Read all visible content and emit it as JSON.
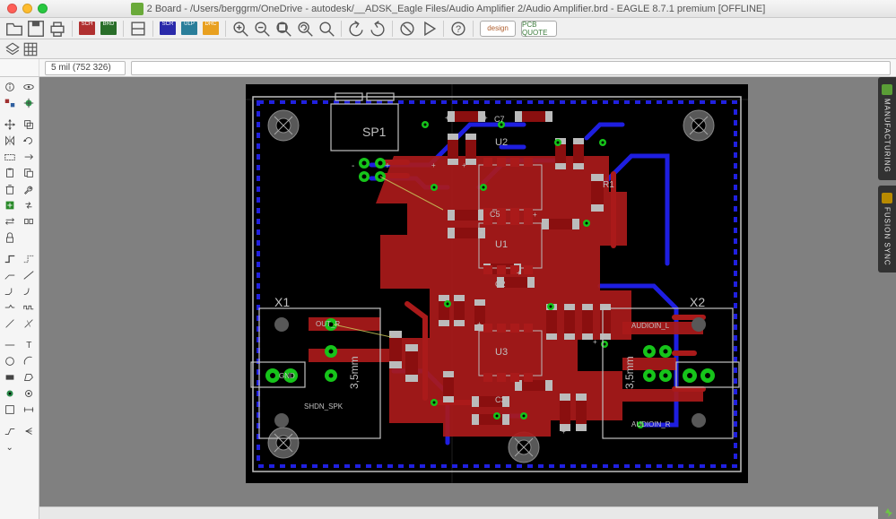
{
  "title": "2 Board - /Users/berggrm/OneDrive - autodesk/__ADSK_Eagle Files/Audio Amplifier 2/Audio Amplifier.brd - EAGLE 8.7.1 premium [OFFLINE]",
  "coord": "5 mil (752 326)",
  "command_input": "",
  "right_tabs": {
    "manufacturing": "MANUFACTURING",
    "fusion_sync": "FUSION SYNC"
  },
  "design_btn_1": "design",
  "design_btn_2": "PCB QUOTE",
  "board": {
    "labels": {
      "sp1": "SP1",
      "x1": "X1",
      "x2": "X2",
      "u1": "U1",
      "u2": "U2",
      "u3": "U3",
      "c7": "C7",
      "c5": "C5",
      "c3": "C3",
      "c2": "C2",
      "r1": "R1",
      "out_r": "OUT_R",
      "gnd": "GND",
      "shdn_spk": "SHDN_SPK",
      "audioin_l": "AUDIOIN_L",
      "audioin_r": "AUDIOIN_R",
      "dim1": "3,5mm",
      "dim2": "3,5mm"
    }
  }
}
